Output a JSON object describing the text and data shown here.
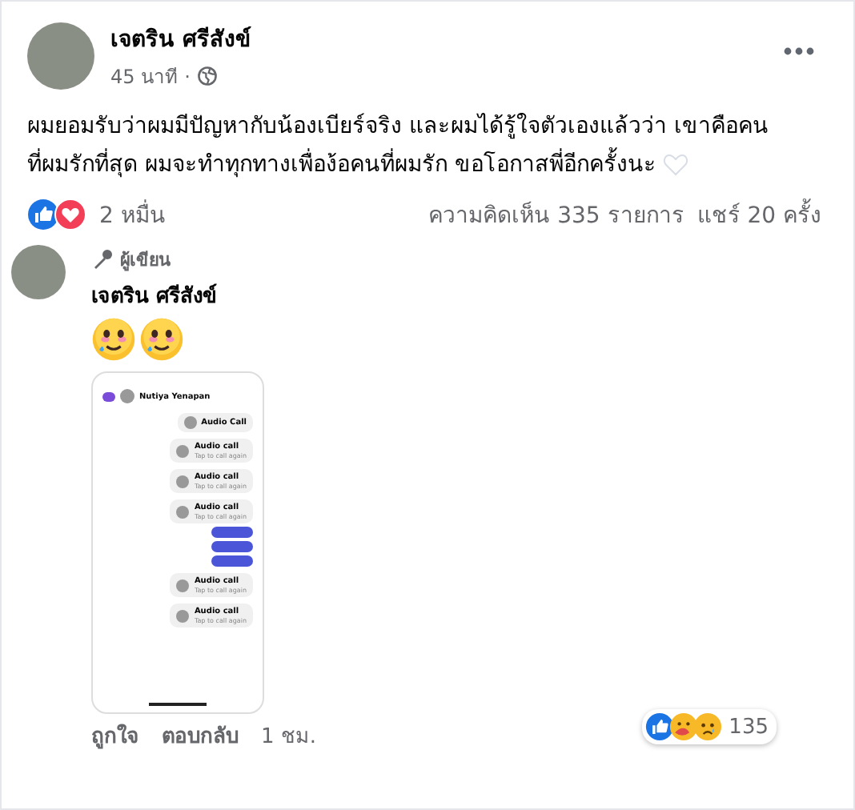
{
  "post": {
    "author": "เจตริน ศรีสังข์",
    "time": "45 นาที",
    "separator": "·",
    "text_lines": [
      "ผมยอมรับว่าผมมีปัญหากับน้องเบียร์จริง และผมได้รู้ใจตัวเองแล้วว่า เขาคือคน",
      "ที่ผมรักที่สุด ผมจะทำทุกทางเพื่อง้อคนที่ผมรัก ขอโอกาสพี่อีกครั้งนะ"
    ],
    "reactions_count": "2 หมื่น",
    "comments": "ความคิดเห็น 335 รายการ",
    "shares": "แชร์ 20 ครั้ง"
  },
  "comment": {
    "badge": "ผู้เขียน",
    "author": "เจตริน ศรีสังข์",
    "emojis": [
      {
        "kind": "teary-face"
      },
      {
        "kind": "teary-face"
      }
    ],
    "chat_screenshot": {
      "contact": "Nutiya Yenapan",
      "messages": [
        {
          "kind": "call",
          "title": "Audio Call"
        },
        {
          "kind": "call",
          "title": "Audio call",
          "subtitle": "Tap to call again"
        },
        {
          "kind": "call",
          "title": "Audio call",
          "subtitle": "Tap to call again"
        },
        {
          "kind": "call",
          "title": "Audio call",
          "subtitle": "Tap to call again"
        },
        {
          "kind": "text"
        },
        {
          "kind": "text"
        },
        {
          "kind": "text"
        },
        {
          "kind": "call",
          "title": "Audio call",
          "subtitle": "Tap to call again"
        },
        {
          "kind": "call",
          "title": "Audio call",
          "subtitle": "Tap to call again"
        }
      ]
    },
    "actions": [
      {
        "label": "ถูกใจ"
      },
      {
        "label": "ตอบกลับ"
      }
    ],
    "time": "1 ชม.",
    "reactions_count": "135"
  }
}
